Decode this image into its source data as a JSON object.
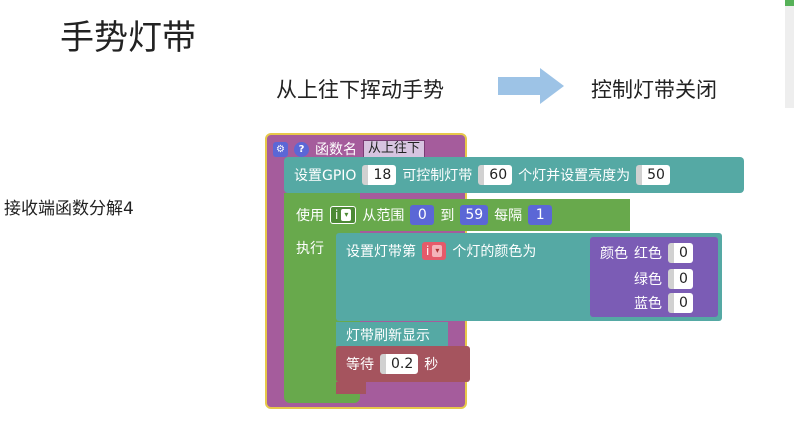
{
  "title": "手势灯带",
  "gesture": "从上往下挥动手势",
  "result": "控制灯带关闭",
  "side_label": "接收端函数分解4",
  "func": {
    "label": "函数名",
    "name": "从上往下"
  },
  "gpio": {
    "label": "设置GPIO",
    "pin": "18",
    "label2": "可控制灯带",
    "count": "60",
    "label3": "个灯并设置亮度为",
    "brightness": "50"
  },
  "loop": {
    "use": "使用",
    "var": "i",
    "from_label": "从范围",
    "from": "0",
    "to_label": "到",
    "to": "59",
    "step_label": "每隔",
    "step": "1"
  },
  "exec_label": "执行",
  "set_led": {
    "label": "设置灯带第",
    "var": "i",
    "label2": "个灯的颜色为"
  },
  "color": {
    "label": "颜色",
    "red_label": "红色",
    "red": "0",
    "green_label": "绿色",
    "green": "0",
    "blue_label": "蓝色",
    "blue": "0"
  },
  "refresh": "灯带刷新显示",
  "wait": {
    "label": "等待",
    "value": "0.2",
    "unit": "秒"
  },
  "colors": {
    "function": "#a55c9c",
    "teal": "#55a9a4",
    "loop": "#68a94c",
    "color_block": "#7b5cb5",
    "wait": "#a5545e",
    "arrow": "#9dc3e6"
  }
}
